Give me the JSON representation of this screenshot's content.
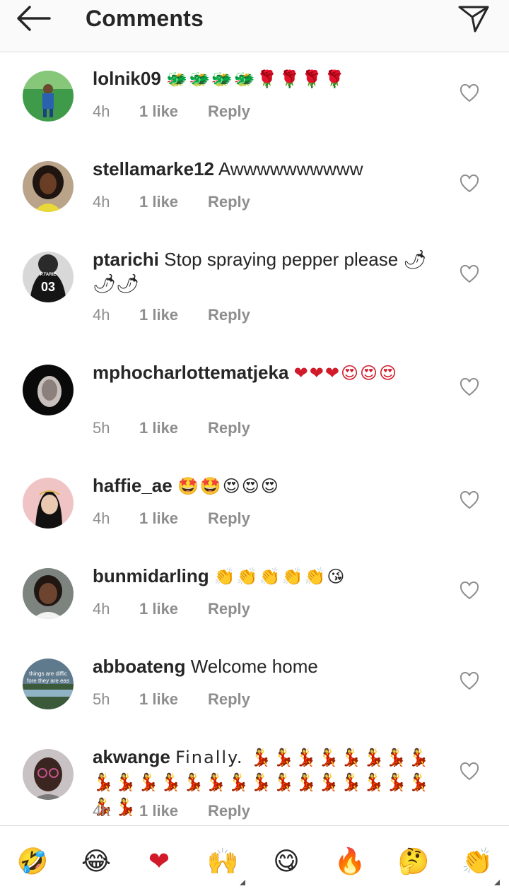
{
  "header": {
    "title": "Comments"
  },
  "comments": [
    {
      "username": "lolnik09",
      "text": "🐲🐲🐲🐲🌹🌹🌹🌹",
      "time": "4h",
      "likes": "1 like",
      "reply": "Reply"
    },
    {
      "username": "stellamarke12",
      "text": "Awwwwwwwwww",
      "time": "4h",
      "likes": "1 like",
      "reply": "Reply"
    },
    {
      "username": "ptarichi",
      "text": "Stop spraying pepper please 🌶🌶🌶",
      "time": "4h",
      "likes": "1 like",
      "reply": "Reply"
    },
    {
      "username": "mphocharlottematjeka",
      "text": "❤❤❤😍😍😍",
      "time": "5h",
      "likes": "1 like",
      "reply": "Reply"
    },
    {
      "username": "haffie_ae",
      "text": "🤩🤩😍😍😍",
      "time": "4h",
      "likes": "1 like",
      "reply": "Reply"
    },
    {
      "username": "bunmidarling",
      "text": "👏👏👏👏👏😘",
      "time": "4h",
      "likes": "1 like",
      "reply": "Reply"
    },
    {
      "username": "abboateng",
      "text": "Welcome home",
      "time": "5h",
      "likes": "1 like",
      "reply": "Reply"
    },
    {
      "username": "akwange",
      "text": "Finally. 💃💃💃💃💃💃💃💃💃💃💃💃💃💃💃💃💃💃💃💃💃💃💃💃💃",
      "time": "4h",
      "likes": "1 like",
      "reply": "Reply"
    }
  ],
  "avatar_texts": {
    "ptarichi_name": "P.TARIE",
    "ptarichi_number": "03",
    "abboateng_line1": "things are diffic",
    "abboateng_line2": "fore they are eas"
  },
  "reactions": [
    "🤣",
    "😂",
    "❤",
    "🙌",
    "😋",
    "🔥",
    "🤔",
    "👏"
  ],
  "icons": {
    "back": "arrow-left-icon",
    "send": "paper-plane-icon",
    "like": "heart-outline-icon"
  },
  "colors": {
    "text": "#262626",
    "meta": "#8e8e8e",
    "divider": "#dbdbdb",
    "header_bg": "#fafafa"
  }
}
